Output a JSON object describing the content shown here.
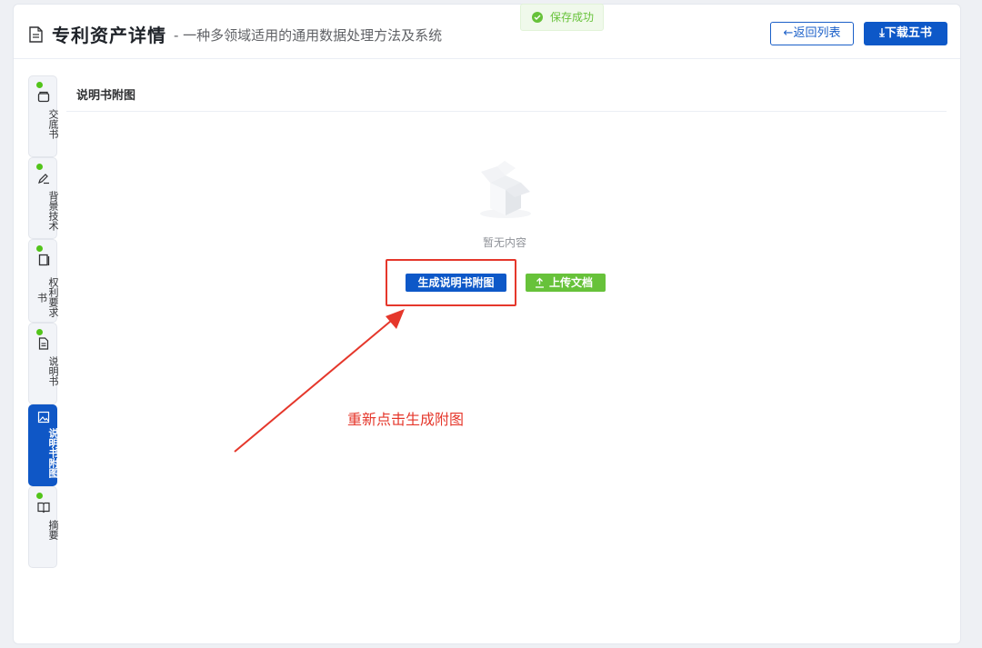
{
  "header": {
    "title": "专利资产详情",
    "subtitle": "- 一种多领域适用的通用数据处理方法及系统",
    "back_button": "←返回列表",
    "download_button": "下载五书"
  },
  "toast": {
    "message": "保存成功"
  },
  "sidebar": {
    "tabs": [
      {
        "label": "交底书",
        "icon": "folder-icon",
        "done": true,
        "active": false
      },
      {
        "label": "背景技术",
        "icon": "pen-icon",
        "done": true,
        "active": false
      },
      {
        "label": "权利要求书",
        "icon": "book-icon",
        "done": true,
        "active": false
      },
      {
        "label": "说明书",
        "icon": "document-icon",
        "done": true,
        "active": false
      },
      {
        "label": "说明书附图",
        "icon": "image-icon",
        "done": false,
        "active": true
      },
      {
        "label": "摘要",
        "icon": "open-book-icon",
        "done": true,
        "active": false
      }
    ]
  },
  "main": {
    "section_title": "说明书附图",
    "empty_text": "暂无内容",
    "generate_button": "生成说明书附图",
    "upload_button": "上传文档"
  },
  "annotation": {
    "text": "重新点击生成附图"
  },
  "colors": {
    "primary": "#0d58c8",
    "success": "#67c23a",
    "annotation_red": "#e5372b"
  }
}
